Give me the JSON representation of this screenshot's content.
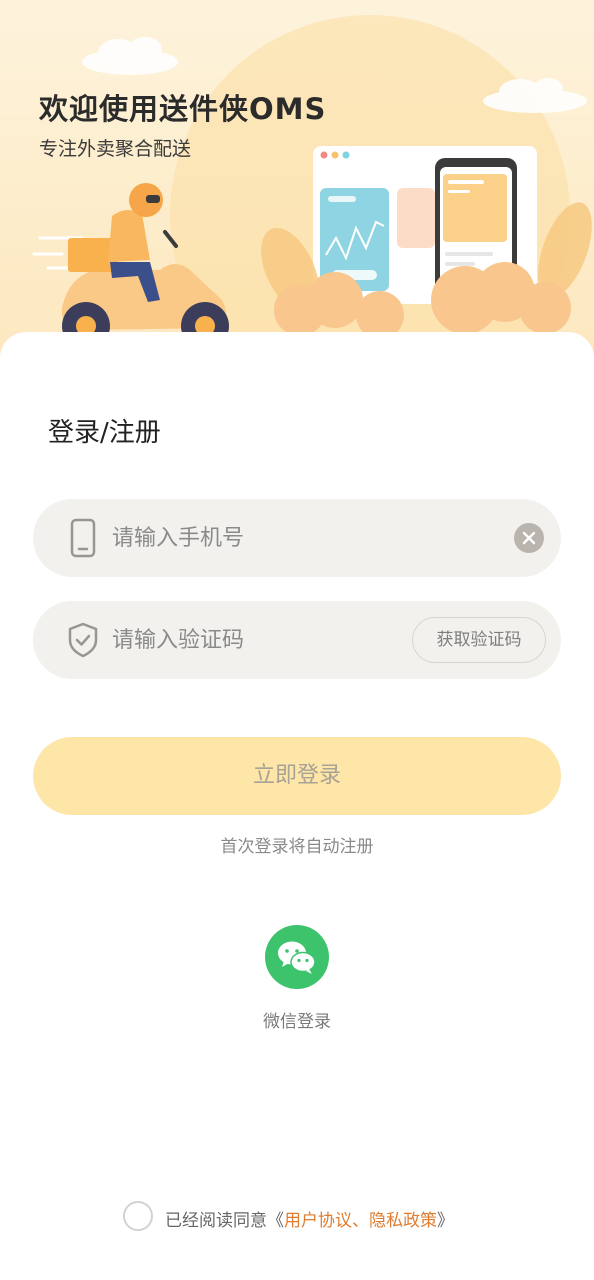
{
  "hero": {
    "title": "欢迎使用送件侠OMS",
    "subtitle": "专注外卖聚合配送"
  },
  "form": {
    "title": "登录/注册",
    "phone_placeholder": "请输入手机号",
    "code_placeholder": "请输入验证码",
    "get_code_label": "获取验证码",
    "login_label": "立即登录",
    "auto_register_hint": "首次登录将自动注册"
  },
  "wechat": {
    "label": "微信登录",
    "color": "#3dc36c"
  },
  "agreement": {
    "prefix": "已经阅读同意《",
    "link1": "用户协议",
    "separator": "、",
    "link2": "隐私政策",
    "suffix": "》",
    "link_color": "#e07c2f"
  },
  "icons": {
    "phone": "mobile-phone-icon",
    "code": "shield-check-icon",
    "clear": "clear-icon",
    "wechat": "wechat-icon"
  },
  "colors": {
    "accent": "#fde6a8",
    "hero_bg": "#fde8bf"
  }
}
